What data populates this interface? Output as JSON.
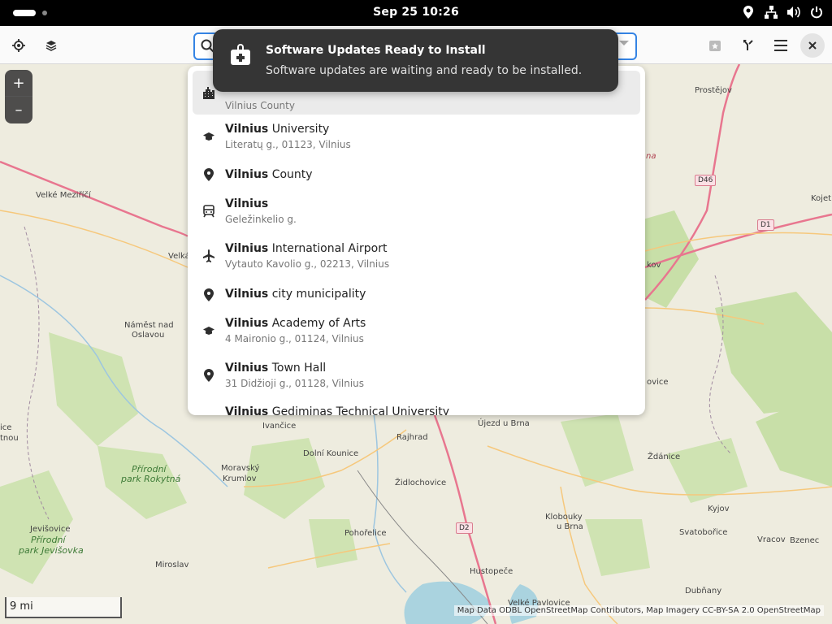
{
  "topbar": {
    "clock": "Sep 25  10:26",
    "tray_icons": [
      "location-icon",
      "network-icon",
      "volume-icon",
      "power-icon"
    ]
  },
  "headerbar": {
    "buttons_left": [
      "locate-icon",
      "layers-icon"
    ],
    "buttons_right": [
      "favorites-icon",
      "route-icon",
      "menu-icon",
      "close-icon"
    ],
    "search": {
      "value": "",
      "placeholder": ""
    }
  },
  "notification": {
    "icon": "software-update-icon",
    "title": "Software Updates Ready to Install",
    "body": "Software updates are waiting and ready to be installed."
  },
  "results": [
    {
      "icon": "city-icon",
      "bold": "",
      "rest": "",
      "sub": "Vilnius County",
      "selected": true
    },
    {
      "icon": "education-icon",
      "bold": "Vilnius",
      "rest": " University",
      "sub": "Literatų g., 01123, Vilnius"
    },
    {
      "icon": "place-icon",
      "bold": "Vilnius",
      "rest": " County",
      "sub": ""
    },
    {
      "icon": "train-icon",
      "bold": "Vilnius",
      "rest": "",
      "sub": "Geležinkelio g."
    },
    {
      "icon": "airport-icon",
      "bold": "Vilnius",
      "rest": " International Airport",
      "sub": "Vytauto Kavolio g., 02213, Vilnius"
    },
    {
      "icon": "place-icon",
      "bold": "Vilnius",
      "rest": " city municipality",
      "sub": ""
    },
    {
      "icon": "education-icon",
      "bold": "Vilnius",
      "rest": " Academy of Arts",
      "sub": "4 Maironio g., 01124, Vilnius"
    },
    {
      "icon": "place-icon",
      "bold": "Vilnius",
      "rest": " Town Hall",
      "sub": "31 Didžioji g., 01128, Vilnius"
    },
    {
      "icon": "education-icon",
      "bold": "Vilnius",
      "rest": " Gediminas Technical University",
      "sub": ""
    }
  ],
  "map": {
    "zoom_in": "+",
    "zoom_out": "–",
    "scale": "9 mi",
    "attribution": "Map Data ODBL OpenStreetMap Contributors, Map Imagery CC-BY-SA 2.0 OpenStreetMap",
    "labels": [
      "Prostějov",
      "Kojet",
      "Velké Meziříčí",
      "Velká",
      "kov",
      "Náměst nad",
      "Oslavou",
      "ovice",
      "ice",
      "tnou",
      "Ivančice",
      "Rajhrad",
      "Újezd u Brna",
      "Ždánice",
      "Moravský",
      "Krumlov",
      "Dolní Kounice",
      "Židlochovice",
      "Přírodní",
      "park Rokytná",
      "Klobouky",
      "u Brna",
      "Kyjov",
      "Jevišovice",
      "Přírodní",
      "park Jevišovka",
      "Pohořelice",
      "Svatobořice",
      "Vracov",
      "Bzenec",
      "Miroslav",
      "Hustopeče",
      "Dubňany",
      "Velké Pavlovice",
      "na"
    ],
    "road_signs": [
      "D46",
      "D1",
      "D2"
    ]
  },
  "colors": {
    "accent": "#3584e4",
    "notification_bg": "#353535",
    "forest": "#c8dfa8",
    "motorway": "#e8768f",
    "water": "#aad3df"
  }
}
